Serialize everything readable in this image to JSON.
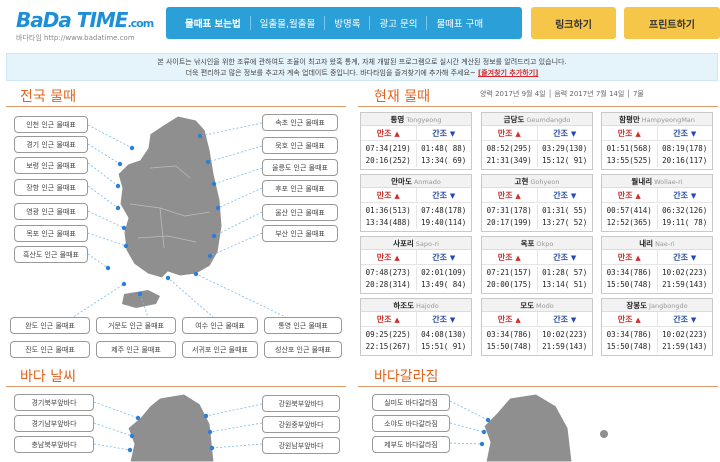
{
  "header": {
    "logo_main": "BaDa TIME",
    "logo_dot": ".com",
    "logo_sub": "바다타임 http://www.badatime.com",
    "nav": [
      "물때표 보는법",
      "일출몰,월출몰",
      "방명록",
      "광고 문의",
      "물때표 구매"
    ],
    "link_button": "링크하기",
    "print_button": "프린트하기"
  },
  "notice": {
    "line1": "본 사이트는 낚시인을 위한 조류에 관하여도 조율이 최고자 왔혹 통계, 자체 개발된 프로그램으로 실시간 계산된 정보를 알려드리고 있습니다.",
    "line2": "더욱 편리하고 많은 정보를 추고자 계속 업데이트 중입니다. 바다타임을 즐겨찾기에 추가해 주세요~",
    "bookmark_link": "[즐겨찾기 추가하기]"
  },
  "sections": {
    "national_tide": "전국 물때",
    "current_tide": "현재 물때",
    "sea_weather": "바다 날씨",
    "sea_fishing": "바다갈라짐"
  },
  "current_date": "양력 2017년 9월 4일 │ 음력 2017년 7월 14일 │ 7물",
  "tide_labels": {
    "high": "만조",
    "low": "간조",
    "up_arrow": "▲",
    "down_arrow": "▼"
  },
  "tide_cards": [
    {
      "name": "통영",
      "en": "Tongyeong",
      "rows": [
        [
          "07:34(219)",
          "01:48( 88)"
        ],
        [
          "20:16(252)",
          "13:34( 69)"
        ]
      ]
    },
    {
      "name": "금당도",
      "en": "Geumdangdo",
      "rows": [
        [
          "08:52(295)",
          "03:29(130)"
        ],
        [
          "21:31(349)",
          "15:12( 91)"
        ]
      ]
    },
    {
      "name": "함평만",
      "en": "HampyeongMan",
      "rows": [
        [
          "01:51(568)",
          "08:19(178)"
        ],
        [
          "13:55(525)",
          "20:16(117)"
        ]
      ]
    },
    {
      "name": "안마도",
      "en": "Anmado",
      "rows": [
        [
          "01:36(513)",
          "07:48(178)"
        ],
        [
          "13:34(488)",
          "19:40(114)"
        ]
      ]
    },
    {
      "name": "고현",
      "en": "Gohyeon",
      "rows": [
        [
          "07:31(178)",
          "01:31( 55)"
        ],
        [
          "20:17(199)",
          "13:27( 52)"
        ]
      ]
    },
    {
      "name": "월내리",
      "en": "Wollae-ri",
      "rows": [
        [
          "00:57(414)",
          "06:32(126)"
        ],
        [
          "12:52(365)",
          "19:11( 78)"
        ]
      ]
    },
    {
      "name": "사포리",
      "en": "Sapo-ri",
      "rows": [
        [
          "07:48(273)",
          "02:01(109)"
        ],
        [
          "20:28(314)",
          "13:49( 84)"
        ]
      ]
    },
    {
      "name": "옥포",
      "en": "Okpo",
      "rows": [
        [
          "07:21(157)",
          "01:28( 57)"
        ],
        [
          "20:00(175)",
          "13:14( 51)"
        ]
      ]
    },
    {
      "name": "내리",
      "en": "Nae-ri",
      "rows": [
        [
          "03:34(786)",
          "10:02(223)"
        ],
        [
          "15:50(748)",
          "21:59(143)"
        ]
      ]
    },
    {
      "name": "하조도",
      "en": "Hajodo",
      "rows": [
        [
          "09:25(225)",
          "04:08(130)"
        ],
        [
          "22:15(267)",
          "15:51( 91)"
        ]
      ]
    },
    {
      "name": "모도",
      "en": "Modo",
      "rows": [
        [
          "03:34(786)",
          "10:02(223)"
        ],
        [
          "15:50(748)",
          "21:59(143)"
        ]
      ]
    },
    {
      "name": "장봉도",
      "en": "Jangbongdo",
      "rows": [
        [
          "03:34(786)",
          "10:02(223)"
        ],
        [
          "15:50(748)",
          "21:59(143)"
        ]
      ]
    }
  ],
  "region_buttons": {
    "left": [
      "인천 인근 물때표",
      "경기 인근 물때표",
      "보령 인근 물때표",
      "장항 인근 물때표",
      "영광 인근 물때표",
      "목포 인근 물때표",
      "흑산도 인근 물때표"
    ],
    "right": [
      "속초 인근 물때표",
      "묵호 인근 물때표",
      "울릉도 인근 물때표",
      "후포 인근 물때표",
      "울산 인근 물때표",
      "부산 인근 물때표"
    ],
    "bottom1": [
      "완도 인근 물때표",
      "거문도 인근 물때표",
      "여수 인근 물때표",
      "통영 인근 물때표"
    ],
    "bottom2": [
      "진도 인근 물때표",
      "제주 인근 물때표",
      "서귀포 인근 물때표",
      "성산포 인근 물때표"
    ]
  },
  "weather_buttons": {
    "left": [
      "경기북부앞바다",
      "경기남부앞바다",
      "충남북부앞바다"
    ],
    "right": [
      "강원북부앞바다",
      "강원중부앞바다",
      "강원남부앞바다"
    ]
  },
  "fishing_buttons": [
    "실미도 바다갈라짐",
    "소야도 바다갈라짐",
    "제부도 바다갈라짐",
    "무창포 바다갈라짐"
  ],
  "colors": {
    "accent": "#2a9fd8",
    "title": "#e2631e",
    "yellow": "#f6c648",
    "map": "#8f8f8f"
  }
}
